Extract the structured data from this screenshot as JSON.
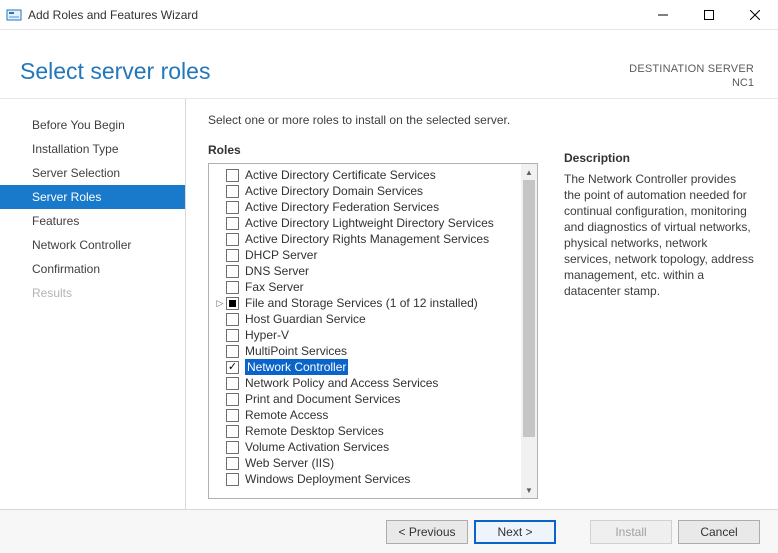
{
  "window": {
    "title": "Add Roles and Features Wizard"
  },
  "header": {
    "pageTitle": "Select server roles",
    "destLabel": "DESTINATION SERVER",
    "destValue": "NC1"
  },
  "sidebar": {
    "items": [
      {
        "label": "Before You Begin",
        "state": "normal"
      },
      {
        "label": "Installation Type",
        "state": "normal"
      },
      {
        "label": "Server Selection",
        "state": "normal"
      },
      {
        "label": "Server Roles",
        "state": "active"
      },
      {
        "label": "Features",
        "state": "normal"
      },
      {
        "label": "Network Controller",
        "state": "normal"
      },
      {
        "label": "Confirmation",
        "state": "normal"
      },
      {
        "label": "Results",
        "state": "dim"
      }
    ]
  },
  "main": {
    "instruction": "Select one or more roles to install on the selected server.",
    "rolesHeader": "Roles",
    "roles": [
      {
        "label": "Active Directory Certificate Services",
        "check": "off"
      },
      {
        "label": "Active Directory Domain Services",
        "check": "off"
      },
      {
        "label": "Active Directory Federation Services",
        "check": "off"
      },
      {
        "label": "Active Directory Lightweight Directory Services",
        "check": "off"
      },
      {
        "label": "Active Directory Rights Management Services",
        "check": "off"
      },
      {
        "label": "DHCP Server",
        "check": "off"
      },
      {
        "label": "DNS Server",
        "check": "off"
      },
      {
        "label": "Fax Server",
        "check": "off"
      },
      {
        "label": "File and Storage Services (1 of 12 installed)",
        "check": "partial",
        "expandable": true
      },
      {
        "label": "Host Guardian Service",
        "check": "off"
      },
      {
        "label": "Hyper-V",
        "check": "off"
      },
      {
        "label": "MultiPoint Services",
        "check": "off"
      },
      {
        "label": "Network Controller",
        "check": "on",
        "selected": true
      },
      {
        "label": "Network Policy and Access Services",
        "check": "off"
      },
      {
        "label": "Print and Document Services",
        "check": "off"
      },
      {
        "label": "Remote Access",
        "check": "off"
      },
      {
        "label": "Remote Desktop Services",
        "check": "off"
      },
      {
        "label": "Volume Activation Services",
        "check": "off"
      },
      {
        "label": "Web Server (IIS)",
        "check": "off"
      },
      {
        "label": "Windows Deployment Services",
        "check": "off"
      }
    ],
    "descHeader": "Description",
    "descBody": "The Network Controller provides the point of automation needed for continual configuration, monitoring and diagnostics of virtual networks, physical networks, network services, network topology, address management, etc. within a datacenter stamp."
  },
  "footer": {
    "previous": "< Previous",
    "next": "Next >",
    "install": "Install",
    "cancel": "Cancel"
  }
}
